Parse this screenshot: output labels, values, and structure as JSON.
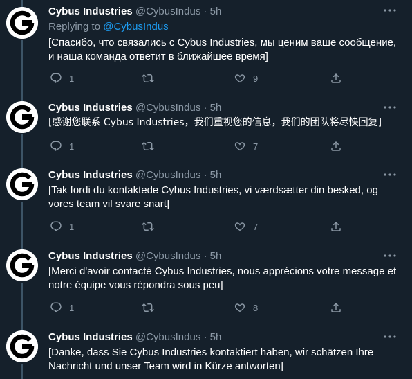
{
  "tweets": [
    {
      "name": "Cybus Industries",
      "handle": "@CybusIndus",
      "sep": "·",
      "time": "5h",
      "replying_label": "Replying to",
      "replying_to": "@CybusIndus",
      "text": "[Спасибо, что связались с Cybus Industries, мы ценим ваше сообщение, и наша команда ответит в ближайшее время]",
      "reply_count": "1",
      "retweet_count": "",
      "like_count": "9"
    },
    {
      "name": "Cybus Industries",
      "handle": "@CybusIndus",
      "sep": "·",
      "time": "5h",
      "text": "[感谢您联系 Cybus Industries，我们重视您的信息，我们的团队将尽快回复]",
      "reply_count": "1",
      "retweet_count": "",
      "like_count": "7"
    },
    {
      "name": "Cybus Industries",
      "handle": "@CybusIndus",
      "sep": "·",
      "time": "5h",
      "text": "[Tak fordi du kontaktede Cybus Industries, vi værdsætter din besked, og vores team vil svare snart]",
      "reply_count": "1",
      "retweet_count": "",
      "like_count": "7"
    },
    {
      "name": "Cybus Industries",
      "handle": "@CybusIndus",
      "sep": "·",
      "time": "5h",
      "text": "[Merci d'avoir contacté Cybus Industries, nous apprécions votre message et notre équipe vous répondra sous peu]",
      "reply_count": "1",
      "retweet_count": "",
      "like_count": "8"
    },
    {
      "name": "Cybus Industries",
      "handle": "@CybusIndus",
      "sep": "·",
      "time": "5h",
      "text": "[Danke, dass Sie Cybus Industries kontaktiert haben, wir schätzen Ihre Nachricht und unser Team wird in Kürze antworten]"
    }
  ],
  "icons": {
    "avatar": "cybus-logo-icon",
    "more": "more-dots-icon",
    "reply": "reply-icon",
    "retweet": "retweet-icon",
    "like": "heart-icon",
    "share": "share-icon"
  },
  "colors": {
    "background": "#15202b",
    "name": "#ffffff",
    "muted": "#8b98a5",
    "link": "#1d9bf0",
    "thread_line": "#3d5466"
  }
}
